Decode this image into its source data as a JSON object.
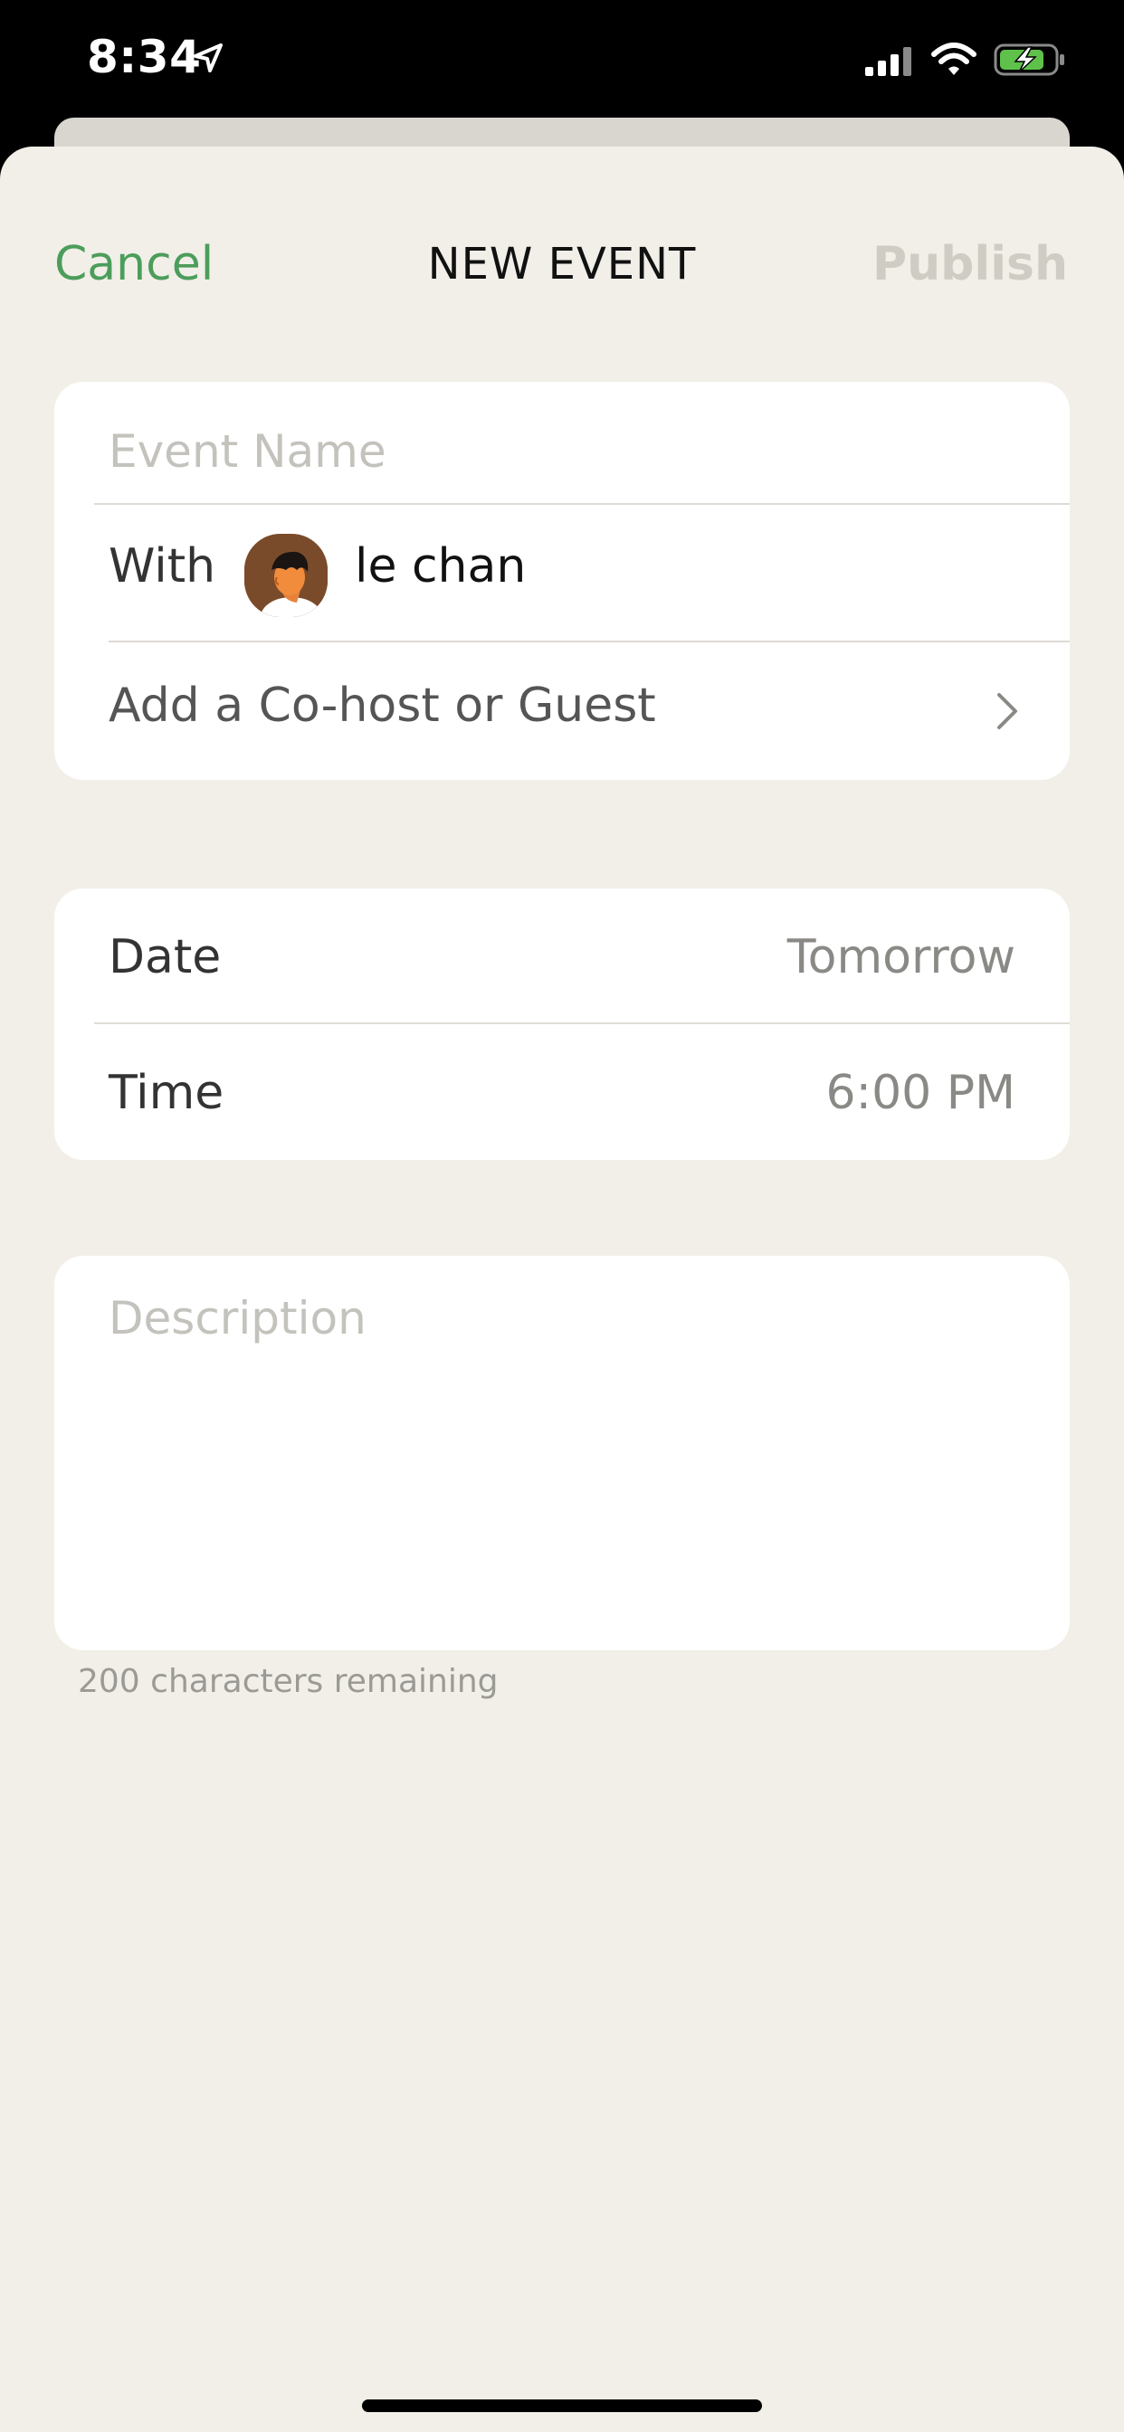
{
  "status_bar": {
    "time": "8:34",
    "icons": [
      "location-arrow-icon",
      "cellular-signal-icon",
      "wifi-icon",
      "battery-charging-icon"
    ],
    "battery_color": "#5ec24a"
  },
  "nav": {
    "cancel_label": "Cancel",
    "title": "NEW EVENT",
    "publish_label": "Publish"
  },
  "event_details": {
    "event_name_placeholder": "Event Name",
    "with_label": "With",
    "host_name": "le chan",
    "add_cohost_label": "Add a Co-host or Guest"
  },
  "schedule": {
    "date_label": "Date",
    "date_value": "Tomorrow",
    "time_label": "Time",
    "time_value": "6:00 PM"
  },
  "description": {
    "placeholder": "Description",
    "chars_remaining": "200 characters remaining"
  },
  "colors": {
    "accent": "#4c9d5b",
    "background": "#f1efe8",
    "card": "#ffffff",
    "disabled": "#cfccc4"
  }
}
